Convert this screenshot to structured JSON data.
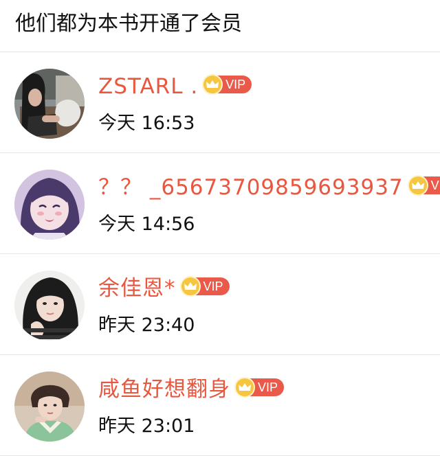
{
  "header": {
    "title": "他们都为本书开通了会员"
  },
  "vip_badge_text": "VIP",
  "colors": {
    "name": "#e9573f",
    "vip_badge": "#e95a4b",
    "crown": "#f6c641"
  },
  "members": [
    {
      "name": "ZSTARL .",
      "time": "今天 16:53",
      "avatar_icon": "avatar-photo-girl-with-cat"
    },
    {
      "name": "？？ _65673709859693937",
      "time": "今天 14:56",
      "avatar_icon": "avatar-anime-girl"
    },
    {
      "name": "余佳恩*",
      "time": "昨天 23:40",
      "avatar_icon": "avatar-photo-girl"
    },
    {
      "name": "咸鱼好想翻身",
      "time": "昨天 23:01",
      "avatar_icon": "avatar-photo-person"
    }
  ]
}
